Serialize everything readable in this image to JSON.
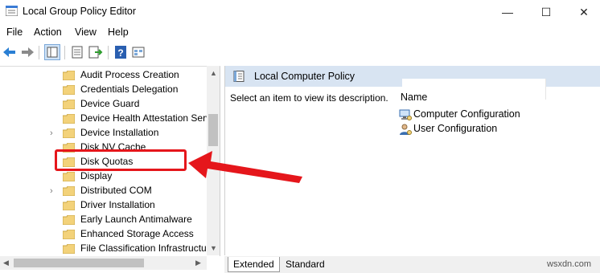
{
  "window": {
    "title": "Local Group Policy Editor",
    "minimize_glyph": "—",
    "maximize_glyph": "☐",
    "close_glyph": "✕"
  },
  "menu": [
    "File",
    "Action",
    "View",
    "Help"
  ],
  "tree": {
    "items": [
      {
        "label": "Audit Process Creation",
        "expandable": false
      },
      {
        "label": "Credentials Delegation",
        "expandable": false
      },
      {
        "label": "Device Guard",
        "expandable": false
      },
      {
        "label": "Device Health Attestation Serv",
        "expandable": false
      },
      {
        "label": "Device Installation",
        "expandable": true
      },
      {
        "label": "Disk NV Cache",
        "expandable": false
      },
      {
        "label": "Disk Quotas",
        "expandable": false
      },
      {
        "label": "Display",
        "expandable": false
      },
      {
        "label": "Distributed COM",
        "expandable": true
      },
      {
        "label": "Driver Installation",
        "expandable": false
      },
      {
        "label": "Early Launch Antimalware",
        "expandable": false
      },
      {
        "label": "Enhanced Storage Access",
        "expandable": false
      },
      {
        "label": "File Classification Infrastructu",
        "expandable": false
      }
    ]
  },
  "right_pane": {
    "header": "Local Computer Policy",
    "description": "Select an item to view its description.",
    "column_name": "Name",
    "items": [
      "Computer Configuration",
      "User Configuration"
    ]
  },
  "tabs": [
    "Extended",
    "Standard"
  ],
  "watermark": "wsxdn.com",
  "colors": {
    "header_bg": "#d8e4f2",
    "annotation_red": "#e5161b",
    "folder_yellow": "#f3d27a"
  }
}
